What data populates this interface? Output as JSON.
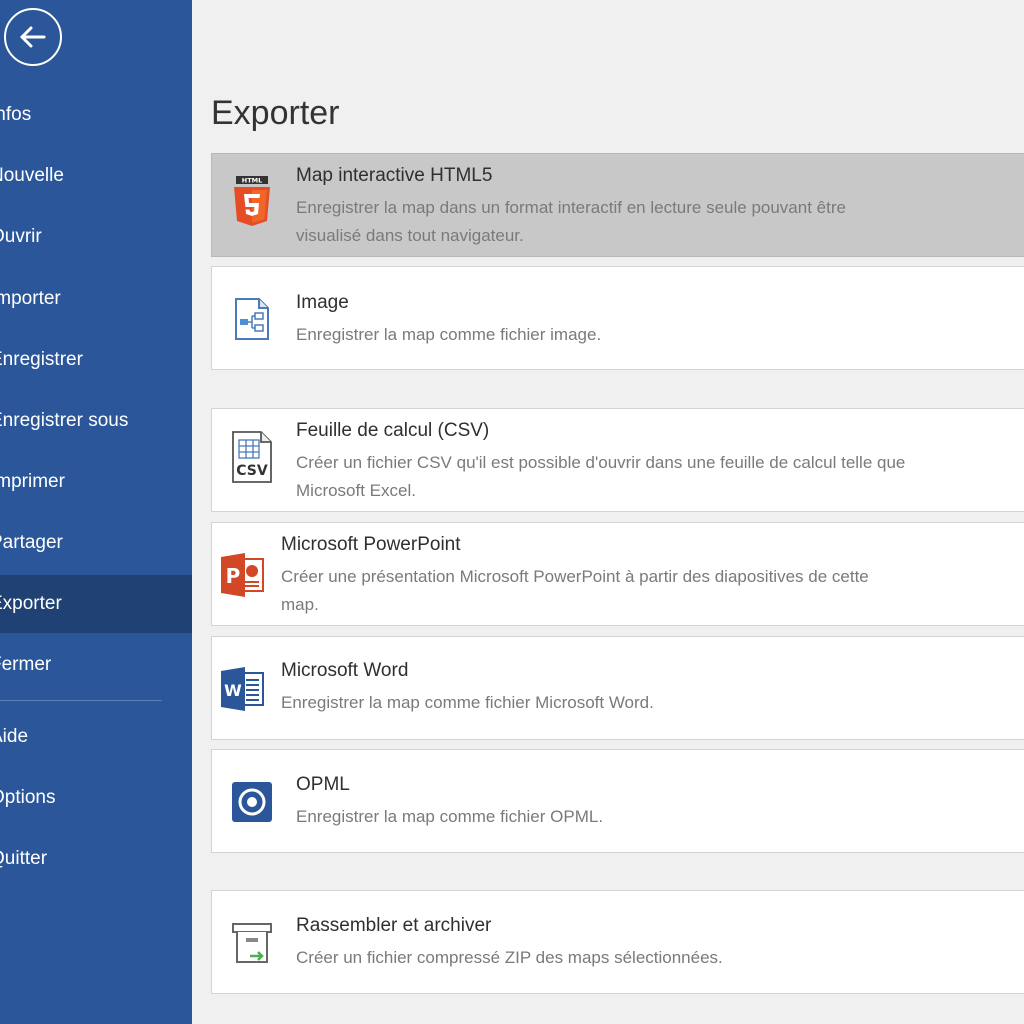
{
  "sidebar": {
    "items": [
      {
        "label": "Infos"
      },
      {
        "label": "Nouvelle"
      },
      {
        "label": "Ouvrir"
      },
      {
        "label": "Importer"
      },
      {
        "label": "Enregistrer"
      },
      {
        "label": "Enregistrer sous"
      },
      {
        "label": "Imprimer"
      },
      {
        "label": "Partager"
      },
      {
        "label": "Exporter"
      },
      {
        "label": "Fermer"
      },
      {
        "label": "Aide"
      },
      {
        "label": "Options"
      },
      {
        "label": "Quitter"
      }
    ],
    "active": "Exporter"
  },
  "main": {
    "title": "Exporter",
    "options": [
      {
        "title": "Map interactive HTML5",
        "desc1": "Enregistrer la map dans un format interactif en lecture seule pouvant être",
        "desc2": "visualisé dans tout navigateur.",
        "icon": "html5-icon",
        "selected": true
      },
      {
        "title": "Image",
        "desc1": "Enregistrer la map comme fichier image.",
        "icon": "image-icon"
      },
      {
        "title": "Feuille de calcul (CSV)",
        "desc1": "Créer un fichier CSV qu'il est possible d'ouvrir dans une feuille de calcul telle que",
        "desc2": "Microsoft Excel.",
        "icon": "csv-icon",
        "icon_text": "CSV"
      },
      {
        "title": "Microsoft PowerPoint",
        "desc1": "Créer une présentation Microsoft PowerPoint à partir des diapositives de cette",
        "desc2": "map.",
        "icon": "powerpoint-icon"
      },
      {
        "title": "Microsoft Word",
        "desc1": "Enregistrer la map comme fichier Microsoft Word.",
        "icon": "word-icon"
      },
      {
        "title": "OPML",
        "desc1": "Enregistrer la map comme fichier OPML.",
        "icon": "opml-icon"
      },
      {
        "title": "Rassembler et archiver",
        "desc1": "Créer un fichier compressé ZIP des maps sélectionnées.",
        "icon": "archive-icon"
      }
    ]
  },
  "colors": {
    "sidebar": "#2b579a",
    "sidebar_active": "#1f4173",
    "html5": "#e44d26",
    "powerpoint": "#d24726",
    "word": "#2b579a",
    "opml": "#2b579a"
  }
}
